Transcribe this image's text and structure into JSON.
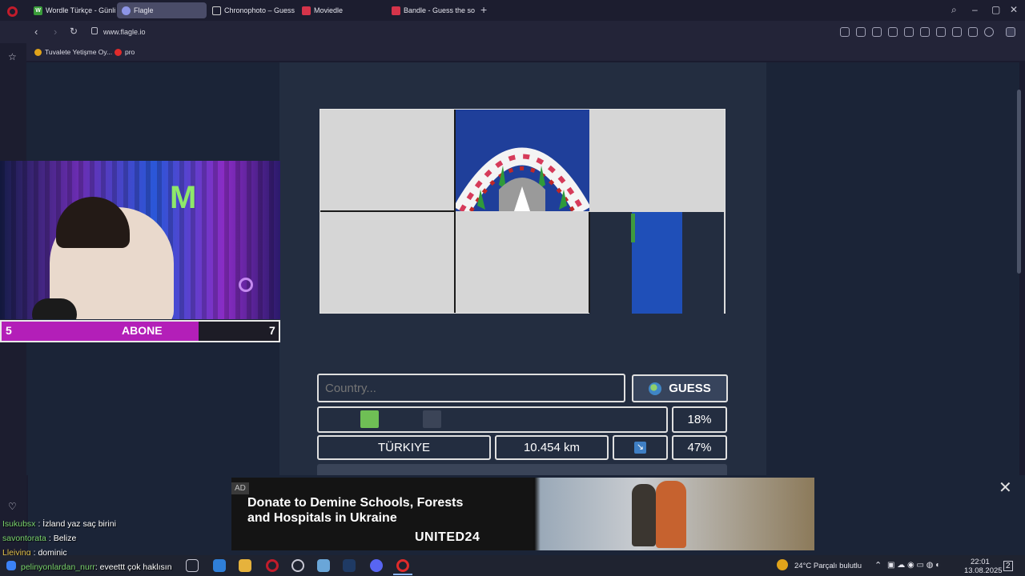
{
  "tabs": [
    {
      "label": "Wordle Türkçe - Günlük K",
      "favicon": "W",
      "color": "#3a9d3a"
    },
    {
      "label": "Flagle",
      "favicon": "",
      "color": "#5e6bd6"
    },
    {
      "label": "Chronophoto – Guess the",
      "favicon": "",
      "color": "#cfcfcf"
    },
    {
      "label": "Moviedle",
      "favicon": "",
      "color": "#d5344a"
    },
    {
      "label": "Bandle - Guess the song,",
      "favicon": "",
      "color": "#d5344a"
    }
  ],
  "url": "www.flagle.io",
  "bookmarks": [
    {
      "label": "Tuvalete Yetişme Oy...",
      "color": "#e0a31a"
    },
    {
      "label": "pro",
      "color": "#e02b2b"
    }
  ],
  "game": {
    "country_placeholder": "Country...",
    "guess_label": "GUESS",
    "progress_percent": "18%",
    "guess_row": {
      "country": "TÜRKIYE",
      "distance": "10.454 km",
      "direction_icon": "arrow-down-right",
      "proximity": "47%"
    }
  },
  "stream": {
    "left_count": "5",
    "label": "ABONE",
    "right_count": "7",
    "progress_fraction": 0.71
  },
  "ad": {
    "tag": "AD",
    "headline": "Donate to Demine Schools, Forests and Hospitals in Ukraine",
    "brand": "UNITED24",
    "close": "✕"
  },
  "chat": [
    {
      "user": "Isukubsx",
      "msg": ": İzland yaz saç birini",
      "color": "#7ad36c"
    },
    {
      "user": "savontorata",
      "msg": ": Belize",
      "color": "#7ad36c"
    },
    {
      "user": "Lleiying",
      "msg": ": dominic",
      "color": "#e3c34c"
    },
    {
      "user": "pelinyonlardan_nurr",
      "msg": ": eveettt çok haklısın",
      "color": "#7ad36c"
    }
  ],
  "tray": {
    "weather": "24°C  Parçalı bulutlu",
    "time": "22:01",
    "date": "13.08.2025",
    "notif": "2"
  }
}
